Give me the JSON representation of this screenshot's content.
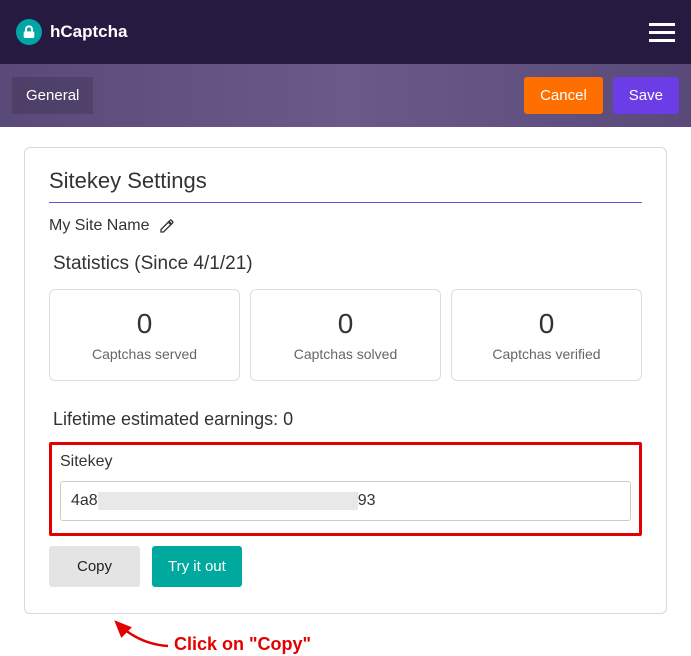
{
  "header": {
    "brand": "hCaptcha"
  },
  "subbar": {
    "tab_general": "General",
    "cancel": "Cancel",
    "save": "Save"
  },
  "page": {
    "title": "Sitekey Settings",
    "site_name": "My Site Name",
    "stats_title": "Statistics (Since 4/1/21)",
    "stats": [
      {
        "value": "0",
        "label": "Captchas served"
      },
      {
        "value": "0",
        "label": "Captchas solved"
      },
      {
        "value": "0",
        "label": "Captchas verified"
      }
    ],
    "earnings_label": "Lifetime estimated earnings: ",
    "earnings_value": "0",
    "sitekey_label": "Sitekey",
    "sitekey_prefix": "4a8",
    "sitekey_suffix": "93",
    "copy": "Copy",
    "try": "Try it out"
  },
  "annotation": {
    "text": "Click on \"Copy\""
  }
}
